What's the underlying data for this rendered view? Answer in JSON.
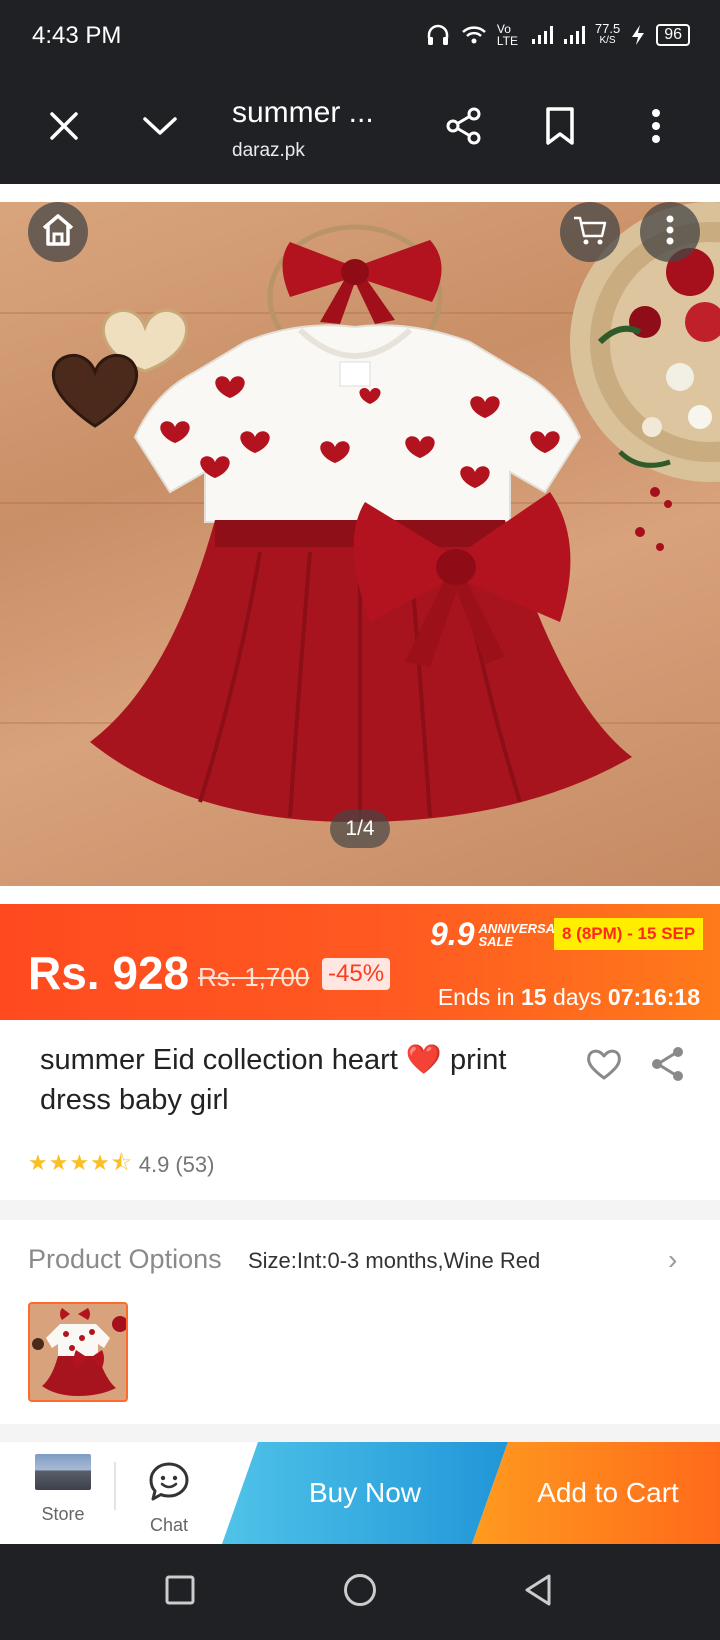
{
  "status_bar": {
    "time": "4:43 PM",
    "network_label": "Vo LTE",
    "speed_value": "77.5",
    "speed_unit": "K/S",
    "battery": "96"
  },
  "browser": {
    "title": "summer ...",
    "domain": "daraz.pk",
    "icons": [
      "close-icon",
      "chevron-down-icon",
      "share-icon",
      "bookmark-icon",
      "more-vert-icon"
    ]
  },
  "gallery": {
    "counter": "1/4",
    "icons": [
      "home-icon",
      "cart-icon",
      "more-vert-icon"
    ]
  },
  "price": {
    "current": "Rs. 928",
    "original": "Rs. 1,700",
    "discount": "-45%",
    "sale_number": "9.9",
    "sale_line1": "ANNIVERSARY",
    "sale_line2": "SALE",
    "sale_dates": "8 (8PM) - 15 SEP",
    "ends_prefix": "Ends in",
    "ends_days": "15",
    "ends_days_label": "days",
    "ends_time": "07:16:18"
  },
  "product": {
    "title": "summer Eid collection heart ❤️ print dress baby girl",
    "rating_value": "4.9",
    "rating_count": "(53)",
    "stars": 4.5
  },
  "options": {
    "label": "Product Options",
    "value": "Size:Int:0-3 months,Wine Red",
    "chevron": "›"
  },
  "actions": {
    "store_label": "Store",
    "chat_label": "Chat",
    "buy_now": "Buy Now",
    "add_to_cart": "Add to Cart"
  },
  "colors": {
    "price_banner": "#ff4a1f",
    "buy_now": "#2196d8",
    "add_to_cart": "#ff7a1a",
    "dress_red": "#a8141e"
  }
}
